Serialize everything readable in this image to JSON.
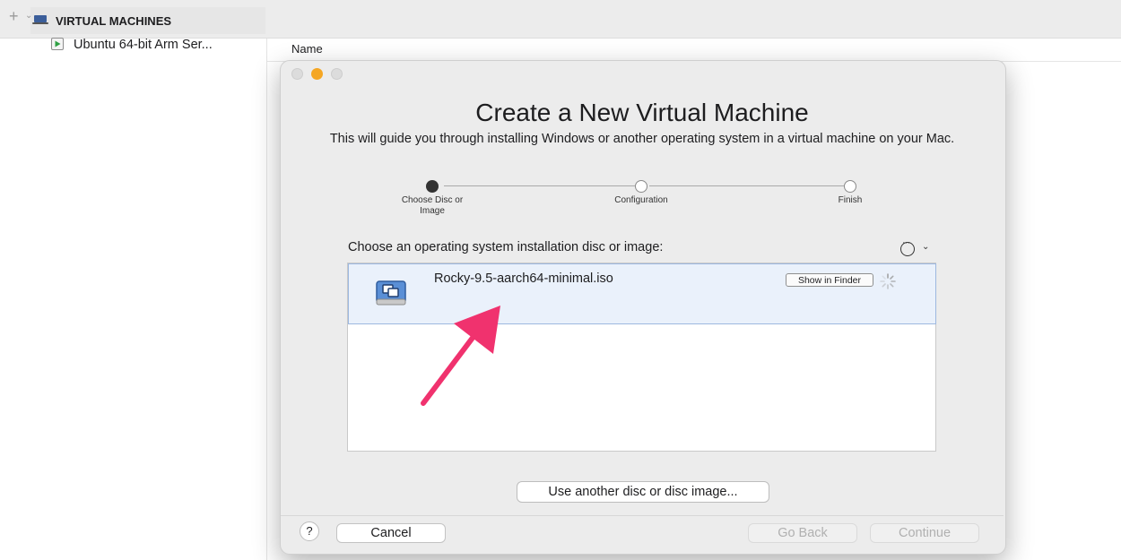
{
  "toolbar": {
    "add_glyph": "+",
    "chevron_glyph": "⌄"
  },
  "sidebar": {
    "header_label": "VIRTUAL MACHINES",
    "items": [
      {
        "label": "Ubuntu 64-bit Arm Ser...",
        "icon": "vm-play-icon"
      }
    ]
  },
  "list": {
    "column_name": "Name"
  },
  "dialog": {
    "title": "Create a New Virtual Machine",
    "subtitle": "This will guide you through installing Windows or another operating system in a virtual machine on your Mac.",
    "steps": [
      {
        "label": "Choose Disc or Image",
        "state": "active"
      },
      {
        "label": "Configuration",
        "state": "pending"
      },
      {
        "label": "Finish",
        "state": "pending"
      }
    ],
    "choose_label": "Choose an operating system installation disc or image:",
    "options_chevron": "⌄",
    "discs": [
      {
        "name": "Rocky-9.5-aarch64-minimal.iso",
        "show_in_finder": "Show in Finder"
      }
    ],
    "use_another_label": "Use another disc or disc image...",
    "help_label": "?",
    "cancel_label": "Cancel",
    "back_label": "Go Back",
    "continue_label": "Continue"
  },
  "colors": {
    "accent_arrow": "#f0326e",
    "traffic_minimize": "#f5a623",
    "selection_bg": "#eaf1fb",
    "disabled_text": "#b0b0b0"
  }
}
